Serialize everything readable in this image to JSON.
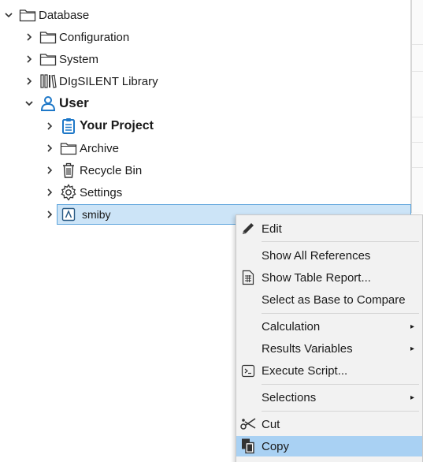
{
  "tree": {
    "root_label": "Database",
    "items": [
      {
        "label": "Configuration"
      },
      {
        "label": "System"
      },
      {
        "label": "DIgSILENT Library"
      },
      {
        "label": "User"
      },
      {
        "label": "Your Project"
      },
      {
        "label": "Archive"
      },
      {
        "label": "Recycle Bin"
      },
      {
        "label": "Settings"
      },
      {
        "label": "smiby"
      }
    ]
  },
  "context_menu": {
    "items": [
      {
        "label": "Edit"
      },
      {
        "label": "Show All References"
      },
      {
        "label": "Show Table Report..."
      },
      {
        "label": "Select as Base to Compare"
      },
      {
        "label": "Calculation"
      },
      {
        "label": "Results Variables"
      },
      {
        "label": "Execute Script..."
      },
      {
        "label": "Selections"
      },
      {
        "label": "Cut"
      },
      {
        "label": "Copy"
      }
    ],
    "submenu_arrow": "▸"
  },
  "colors": {
    "selection_bg": "#cce4f7",
    "selection_border": "#5da4dc",
    "menu_highlight": "#a9d1f3",
    "user_icon": "#1e78c8",
    "project_icon": "#1e78c8"
  }
}
